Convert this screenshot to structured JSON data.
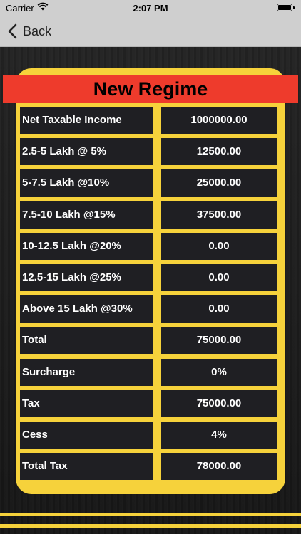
{
  "status_bar": {
    "carrier": "Carrier",
    "time": "2:07 PM"
  },
  "nav": {
    "back_label": "Back"
  },
  "title": "New Regime",
  "rows": [
    {
      "label": "Net Taxable Income",
      "value": "1000000.00"
    },
    {
      "label": "2.5-5 Lakh @ 5%",
      "value": "12500.00"
    },
    {
      "label": "5-7.5 Lakh @10%",
      "value": "25000.00"
    },
    {
      "label": "7.5-10 Lakh @15%",
      "value": "37500.00"
    },
    {
      "label": "10-12.5 Lakh @20%",
      "value": "0.00"
    },
    {
      "label": "12.5-15 Lakh @25%",
      "value": "0.00"
    },
    {
      "label": "Above 15 Lakh @30%",
      "value": "0.00"
    },
    {
      "label": "Total",
      "value": "75000.00"
    },
    {
      "label": "Surcharge",
      "value": "0%"
    },
    {
      "label": "Tax",
      "value": "75000.00"
    },
    {
      "label": "Cess",
      "value": "4%"
    },
    {
      "label": "Total Tax",
      "value": "78000.00"
    }
  ],
  "colors": {
    "accent_yellow": "#f6d23b",
    "banner_red": "#ee3b2c",
    "cell_bg": "#1f1f23"
  }
}
